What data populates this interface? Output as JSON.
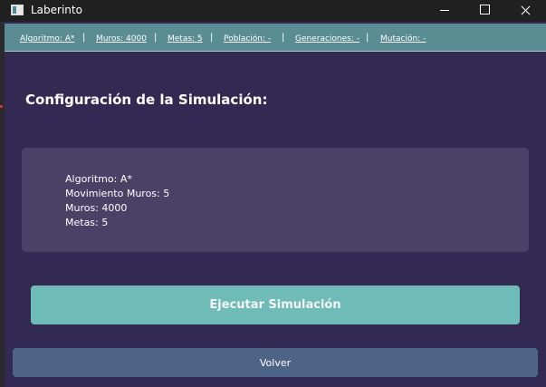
{
  "window": {
    "title": "Laberinto",
    "icon": "app-window-icon"
  },
  "infobar": {
    "items": [
      "Algoritmo: A*",
      "Muros: 4000",
      "Metas: 5",
      "Población: -",
      "Generaciones: -",
      "Mutación: -"
    ],
    "separator": "|"
  },
  "heading": "Configuración de la Simulación:",
  "config": {
    "lines": [
      "Algoritmo: A*",
      "Movimiento Muros: 5",
      "Muros: 4000",
      "Metas: 5"
    ]
  },
  "buttons": {
    "run": "Ejecutar Simulación",
    "back": "Volver"
  },
  "colors": {
    "background": "#332a53",
    "infobar": "#5a8c93",
    "panel": "#494166",
    "run_button": "#6fbbb8",
    "back_button": "#4d6486"
  }
}
